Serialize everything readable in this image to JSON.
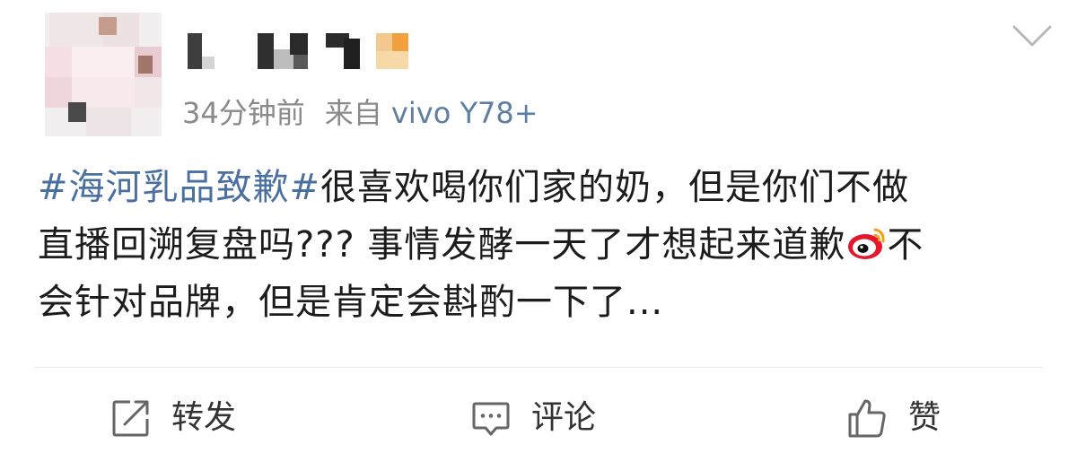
{
  "post": {
    "author": {
      "avatar_icon": "avatar-icon",
      "name_pixelated": true
    },
    "time": "34分钟前",
    "source_prefix": "来自",
    "source_device": "vivo Y78+",
    "hashtag": "#海河乳品致歉#",
    "text_line_1": "很喜欢喝你们家的奶，但是你们不做",
    "text_line_2": "直播回溯复盘吗??? 事情发酵一天了才想起来道歉",
    "text_line_2_emoji": "weibo-logo-icon",
    "text_line_2_end": "不",
    "text_line_3": "会针对品牌，但是肯定会斟酌一下了..."
  },
  "menu": {
    "chevron_icon": "chevron-down-icon"
  },
  "actions": {
    "repost_label": "转发",
    "comment_label": "评论",
    "like_label": "赞"
  },
  "colors": {
    "hashtag": "#4a6fa1",
    "meta_text": "#8a8a8a",
    "device_link": "#5d7ea5",
    "body_text": "#1c1c1c"
  }
}
